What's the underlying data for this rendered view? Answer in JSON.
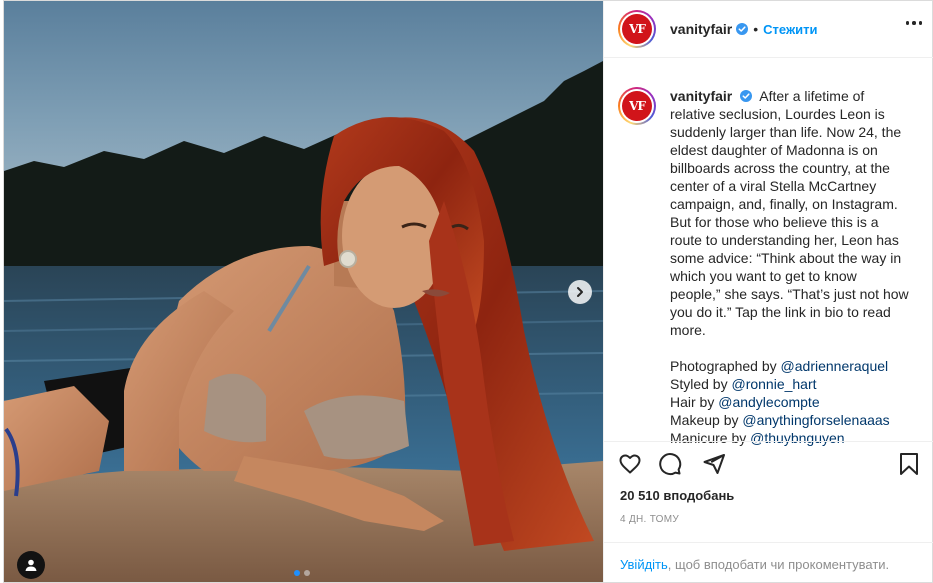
{
  "post": {
    "username": "vanityfair",
    "avatar_text": "VF",
    "follow_label": "Стежити",
    "header_separator": "•",
    "caption_text": "After a lifetime of relative seclusion, Lourdes Leon is suddenly larger than life. Now 24, the eldest daughter of Madonna is on billboards across the country, at the center of a viral Stella McCartney campaign, and, finally, on Instagram. But for those who believe this is a route to understanding her, Leon has some advice: “Think about the way in which you want to get to know people,” she says. “That’s just not how you do it.” Tap the link in bio to read more.",
    "credits": [
      {
        "prefix": "Photographed by ",
        "mention": "@adrienneraquel"
      },
      {
        "prefix": "Styled by ",
        "mention": "@ronnie_hart"
      },
      {
        "prefix": "Hair by ",
        "mention": "@andylecompte"
      },
      {
        "prefix": "Makeup by ",
        "mention": "@anythingforselenaaas"
      },
      {
        "prefix": "Manicure by ",
        "mention": "@thuybnguyen"
      }
    ],
    "likes_text": "20 510 вподобань",
    "time_text": "4 дн. тому",
    "login_link": "Увійдіть",
    "login_rest": ", щоб вподобати чи прокоментувати."
  },
  "carousel": {
    "count": 2,
    "active": 0
  },
  "icons": {
    "verified": "verified-badge-icon",
    "more": "more-options-icon",
    "like": "heart-icon",
    "comment": "comment-icon",
    "share": "paper-plane-icon",
    "save": "bookmark-icon",
    "next": "chevron-right-icon",
    "tags": "user-tag-icon"
  },
  "colors": {
    "accent": "#0095f6",
    "mention": "#00376b",
    "brand_red": "#d1141a",
    "muted": "#8e8e8e",
    "text": "#262626"
  }
}
